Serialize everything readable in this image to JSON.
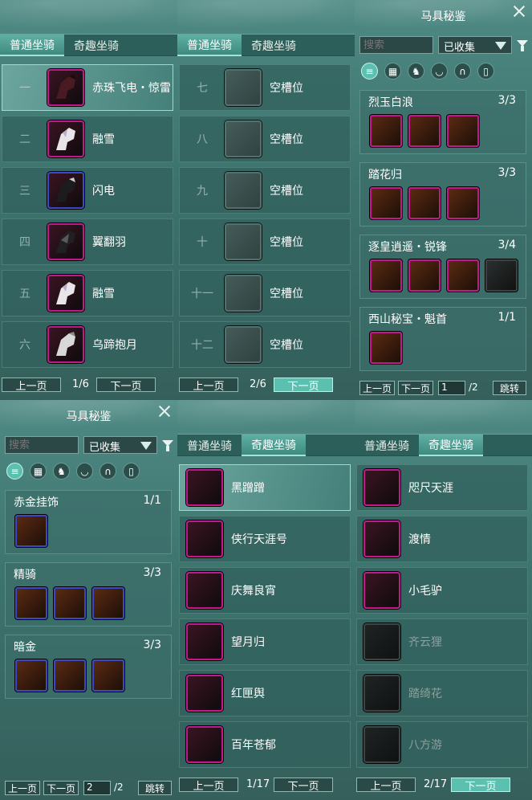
{
  "tabs": {
    "normal": "普通坐骑",
    "fun": "奇趣坐骑"
  },
  "nav": {
    "prev": "上一页",
    "next": "下一页"
  },
  "p1": {
    "rows": [
      {
        "num": "一",
        "name": "赤珠飞电・惊雷"
      },
      {
        "num": "二",
        "name": "融雪"
      },
      {
        "num": "三",
        "name": "闪电"
      },
      {
        "num": "四",
        "name": "翼翻羽"
      },
      {
        "num": "五",
        "name": "融雪"
      },
      {
        "num": "六",
        "name": "乌蹄抱月"
      }
    ],
    "page": "1/6"
  },
  "p2": {
    "rows": [
      {
        "num": "七",
        "name": "空槽位"
      },
      {
        "num": "八",
        "name": "空槽位"
      },
      {
        "num": "九",
        "name": "空槽位"
      },
      {
        "num": "十",
        "name": "空槽位"
      },
      {
        "num": "十一",
        "name": "空槽位"
      },
      {
        "num": "十二",
        "name": "空槽位"
      }
    ],
    "page": "2/6"
  },
  "codex": {
    "title": "马具秘鉴",
    "search_placeholder": "搜索",
    "filter_value": "已收集",
    "jump": "跳转",
    "top": {
      "sets": [
        {
          "name": "烈玉白浪",
          "count": "3/3"
        },
        {
          "name": "踏花归",
          "count": "3/3"
        },
        {
          "name": "逐皇逍遥・锐锋",
          "count": "3/4"
        },
        {
          "name": "西山秘宝・魁首",
          "count": "1/1"
        }
      ],
      "page_input": "1",
      "page_total": "/2"
    },
    "bottom": {
      "sets": [
        {
          "name": "赤金挂饰",
          "count": "1/1"
        },
        {
          "name": "精骑",
          "count": "3/3"
        },
        {
          "name": "暗金",
          "count": "3/3"
        }
      ],
      "page_input": "2",
      "page_total": "/2"
    }
  },
  "p5": {
    "rows": [
      "黑蹭蹭",
      "侠行天涯号",
      "庆舞良宵",
      "望月归",
      "红匣舆",
      "百年苍郁"
    ],
    "page": "1/17"
  },
  "p6": {
    "rows": [
      "咫尺天涯",
      "渡情",
      "小毛驴",
      "齐云狸",
      "踏绮花",
      "八方游"
    ],
    "page": "2/17"
  }
}
